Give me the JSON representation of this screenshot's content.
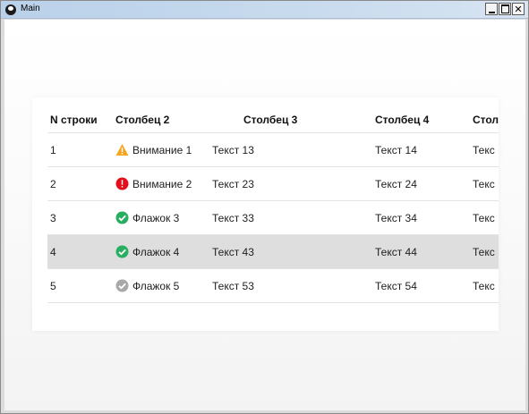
{
  "window": {
    "title": "Main"
  },
  "table": {
    "headers": [
      "N строки",
      "Столбец 2",
      "Столбец 3",
      "Столбец 4",
      "Стол"
    ],
    "rows": [
      {
        "n": "1",
        "icon": "warning-icon",
        "c2": "Внимание 1",
        "c3": "Текст 13",
        "c4": "Текст 14",
        "c5": "Текс",
        "selected": false
      },
      {
        "n": "2",
        "icon": "error-icon",
        "c2": "Внимание 2",
        "c3": "Текст 23",
        "c4": "Текст 24",
        "c5": "Текс",
        "selected": false
      },
      {
        "n": "3",
        "icon": "check-icon",
        "c2": "Флажок 3",
        "c3": "Текст 33",
        "c4": "Текст 34",
        "c5": "Текс",
        "selected": false
      },
      {
        "n": "4",
        "icon": "check-icon",
        "c2": "Флажок 4",
        "c3": "Текст 43",
        "c4": "Текст 44",
        "c5": "Текс",
        "selected": true
      },
      {
        "n": "5",
        "icon": "check-disabled-icon",
        "c2": "Флажок 5",
        "c3": "Текст 53",
        "c4": "Текст 54",
        "c5": "Текс",
        "selected": false
      }
    ]
  },
  "colors": {
    "warning": "#f5a623",
    "error": "#e3101c",
    "check": "#27ae60",
    "check_disabled": "#a8a8a8",
    "selected_row": "#dedede"
  }
}
